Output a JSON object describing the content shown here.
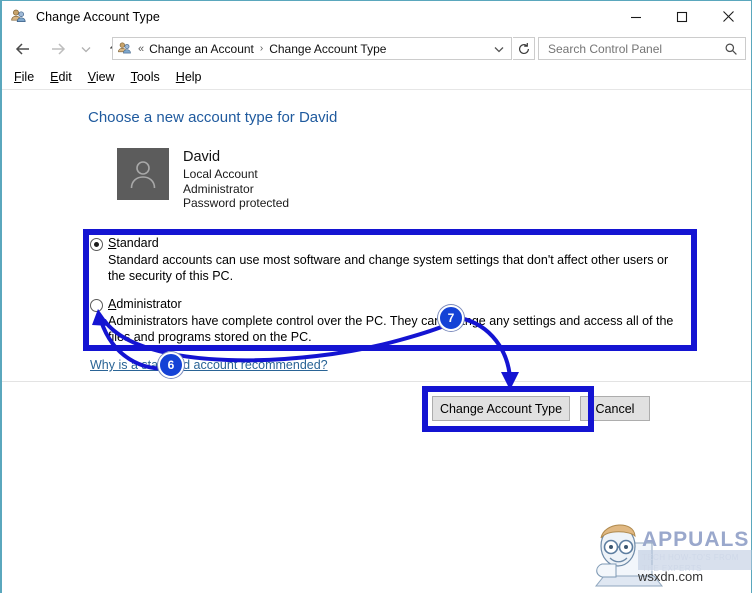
{
  "window": {
    "title": "Change Account Type",
    "icon": "users-accounts-icon",
    "caption": {
      "minimize": "minimize-icon",
      "maximize": "maximize-icon",
      "close": "close-icon"
    }
  },
  "navbar": {
    "back": "back-arrow-icon",
    "forward": "forward-arrow-icon",
    "recent": "recent-pages-chevron-icon",
    "up": "up-arrow-icon",
    "breadcrumb": {
      "icon": "control-panel-users-icon",
      "overflow": "«",
      "items": [
        "Change an Account",
        "Change Account Type"
      ],
      "separator": "›"
    },
    "address_chevron": "chevron-down-icon",
    "refresh": "refresh-icon",
    "search": {
      "placeholder": "Search Control Panel",
      "value": "",
      "icon": "search-icon"
    }
  },
  "menubar": {
    "items": [
      {
        "pre": "",
        "key": "F",
        "post": "ile"
      },
      {
        "pre": "",
        "key": "E",
        "post": "dit"
      },
      {
        "pre": "",
        "key": "V",
        "post": "iew"
      },
      {
        "pre": "",
        "key": "T",
        "post": "ools"
      },
      {
        "pre": "",
        "key": "H",
        "post": "elp"
      }
    ]
  },
  "main": {
    "page_title": "Choose a new account type for David",
    "user": {
      "avatar_icon": "user-avatar-icon",
      "name": "David",
      "lines": [
        "Local Account",
        "Administrator",
        "Password protected"
      ]
    },
    "options": [
      {
        "id": "standard",
        "label_pre": "",
        "label_key": "S",
        "label_post": "tandard",
        "selected": true,
        "description": "Standard accounts can use most software and change system settings that don't affect other users or the security of this PC."
      },
      {
        "id": "administrator",
        "label_pre": "",
        "label_key": "A",
        "label_post": "dministrator",
        "selected": false,
        "description": "Administrators have complete control over the PC. They can change any settings and access all of the files and programs stored on the PC."
      }
    ],
    "help_link": "Why is a standard account recommended?",
    "buttons": {
      "primary": "Change Account Type",
      "cancel": "Cancel"
    }
  },
  "annotations": {
    "highlight_color": "#1414d2",
    "badges": [
      {
        "number": "6",
        "target": "administrator-radio"
      },
      {
        "number": "7",
        "target": "change-account-type-button"
      }
    ],
    "boxes": [
      "account-type-options-box",
      "change-account-type-button-box"
    ]
  },
  "watermark": {
    "brand": "APPUALS",
    "tagline": "TECH HOW-TO'S FROM THE EXPERTS",
    "domain": "wsxdn.com"
  }
}
